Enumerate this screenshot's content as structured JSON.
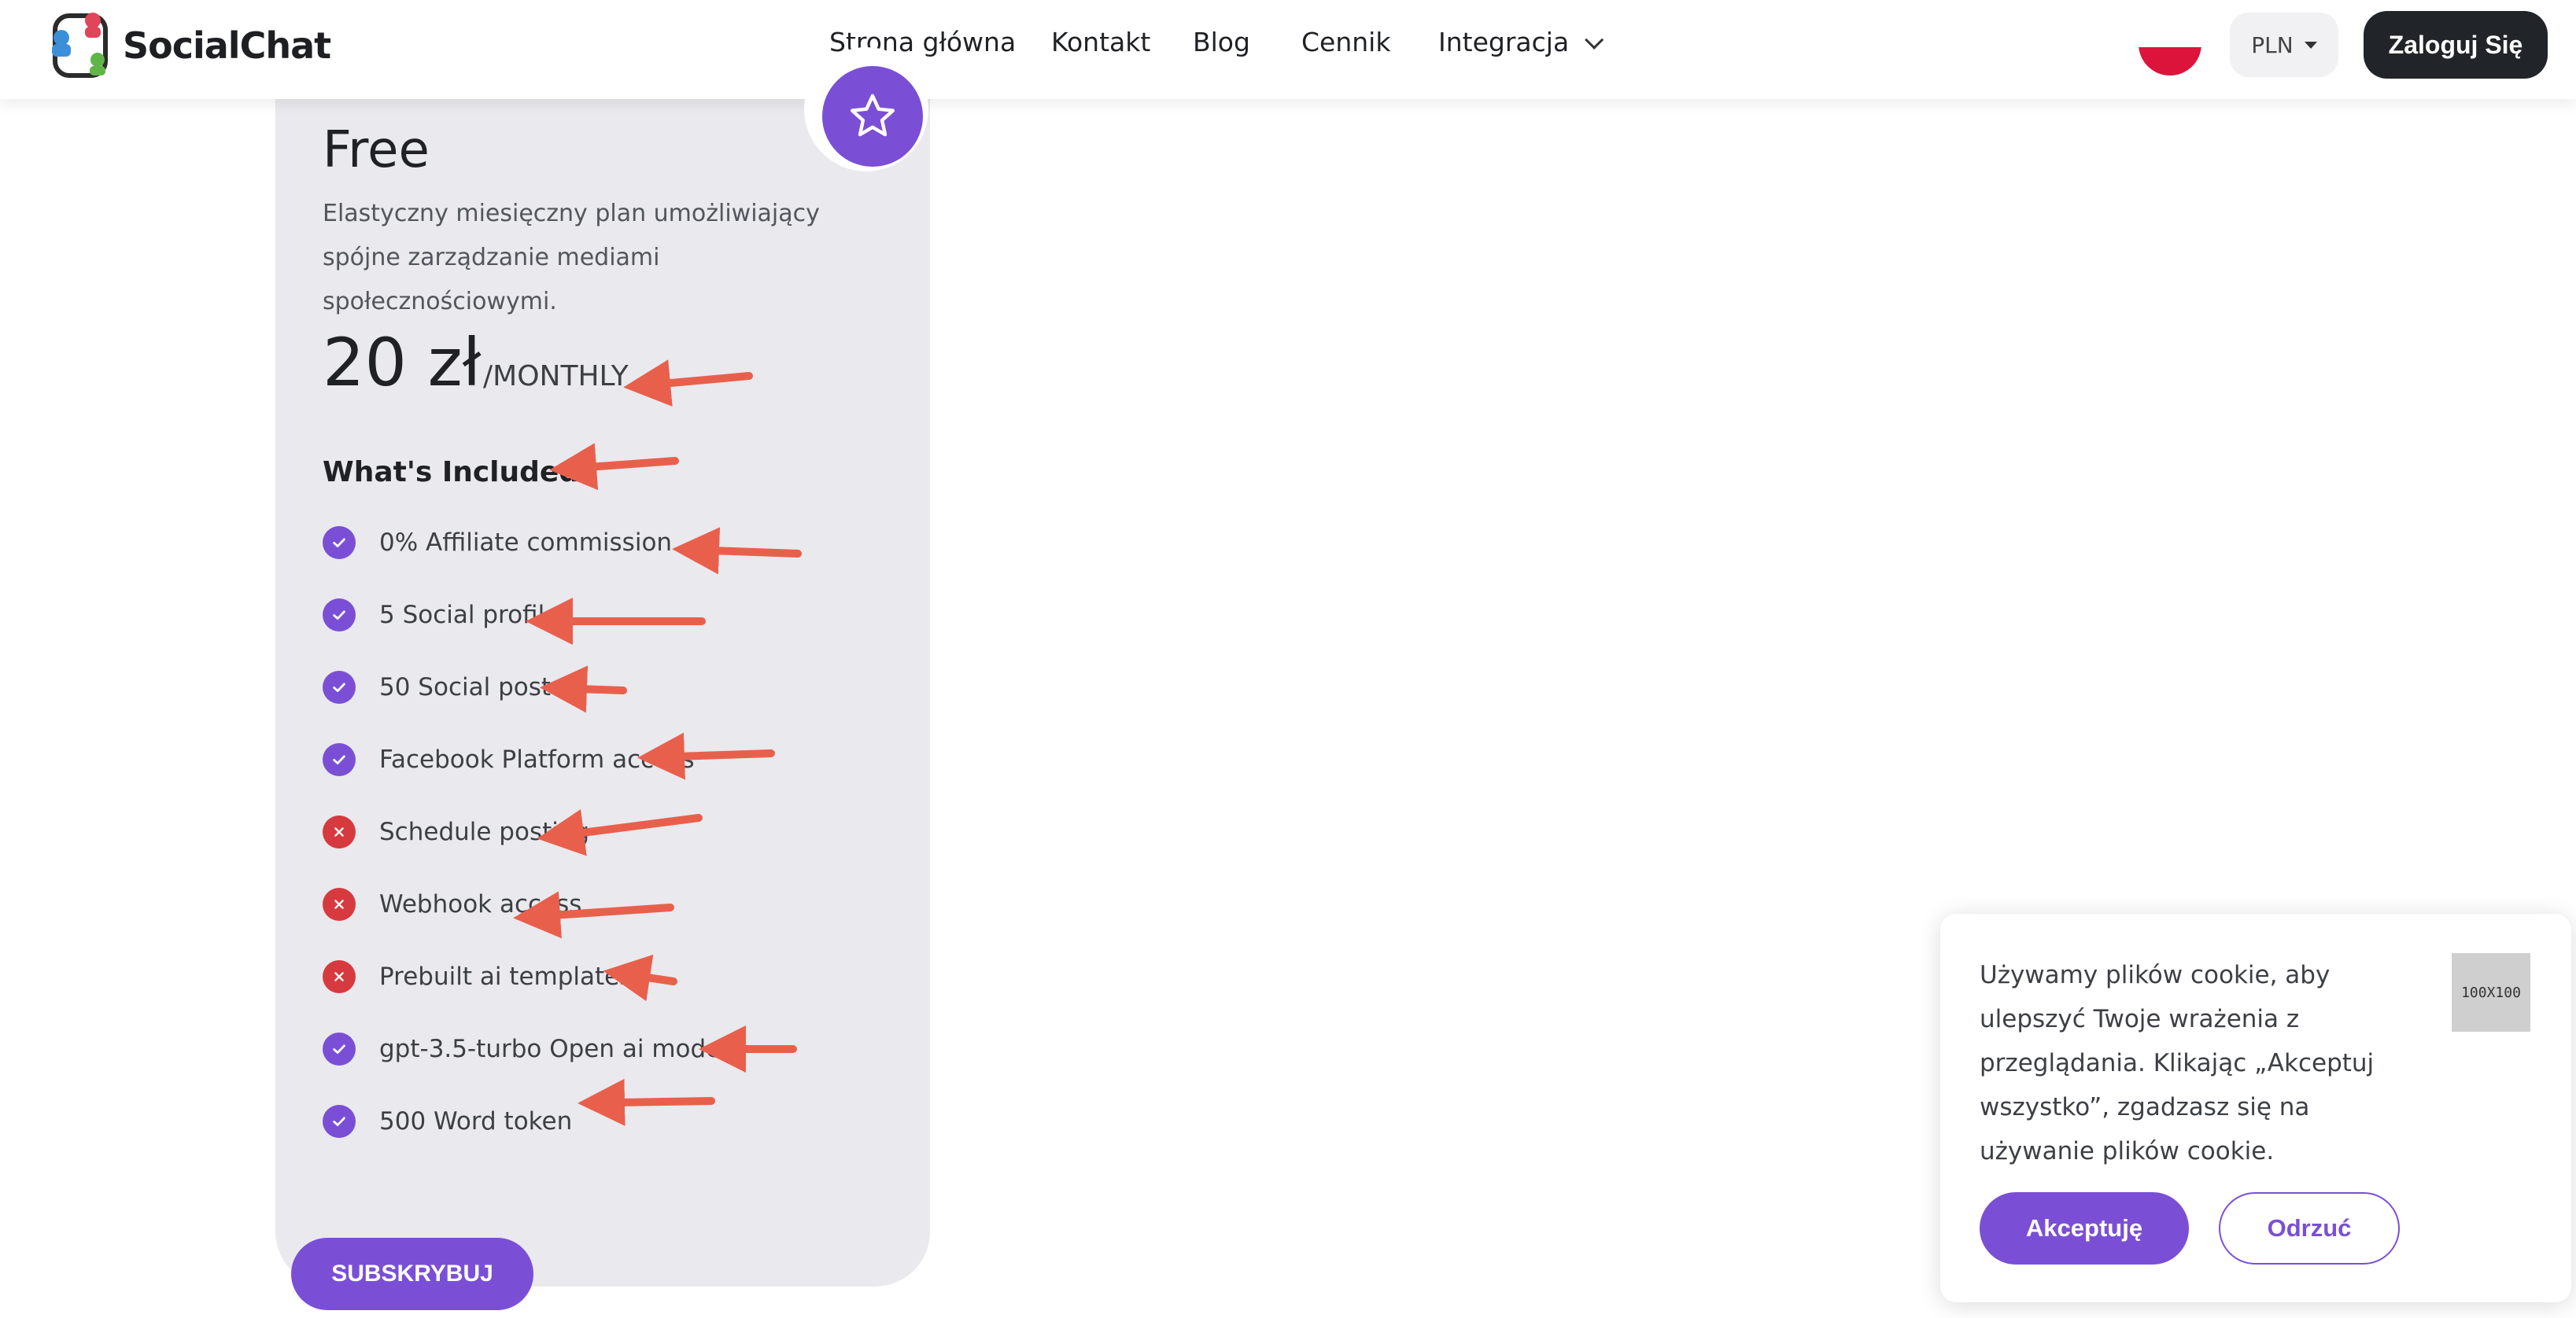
{
  "header": {
    "logo_text": "SocialChat",
    "nav": [
      {
        "label": "Strona główna"
      },
      {
        "label": "Kontakt"
      },
      {
        "label": "Blog"
      },
      {
        "label": "Cennik"
      },
      {
        "label": "Integracja",
        "has_dropdown": true
      }
    ],
    "flag": "poland-flag",
    "currency": "PLN",
    "login_label": "Zaloguj Się"
  },
  "plan": {
    "name": "Free",
    "description": "Elastyczny miesięczny plan umożliwiający spójne zarządzanie mediami społecznościowymi.",
    "price": "20 zł",
    "period": "/MONTHLY",
    "included_heading": "What's Included",
    "features": [
      {
        "label": "0% Affiliate commission",
        "included": true
      },
      {
        "label": "5 Social profile",
        "included": true
      },
      {
        "label": "50 Social post",
        "included": true
      },
      {
        "label": "Facebook Platform access",
        "included": true
      },
      {
        "label": "Schedule posting",
        "included": false
      },
      {
        "label": "Webhook access",
        "included": false
      },
      {
        "label": "Prebuilt ai templates",
        "included": false
      },
      {
        "label": "gpt-3.5-turbo Open ai model",
        "included": true
      },
      {
        "label": "500 Word token",
        "included": true
      }
    ],
    "subscribe_label": "SUBSKRYBUJ"
  },
  "cookie": {
    "text": "Używamy plików cookie, aby ulepszyć Twoje wrażenia z przeglądania. Klikając „Akceptuj wszystko”, zgadzasz się na używanie plików cookie.",
    "image_placeholder": "100X100",
    "accept_label": "Akceptuję",
    "reject_label": "Odrzuć"
  },
  "colors": {
    "accent": "#7a4fd6",
    "excluded": "#d63a3e",
    "dark_button": "#212529",
    "annotation_arrow": "#e8604c"
  }
}
